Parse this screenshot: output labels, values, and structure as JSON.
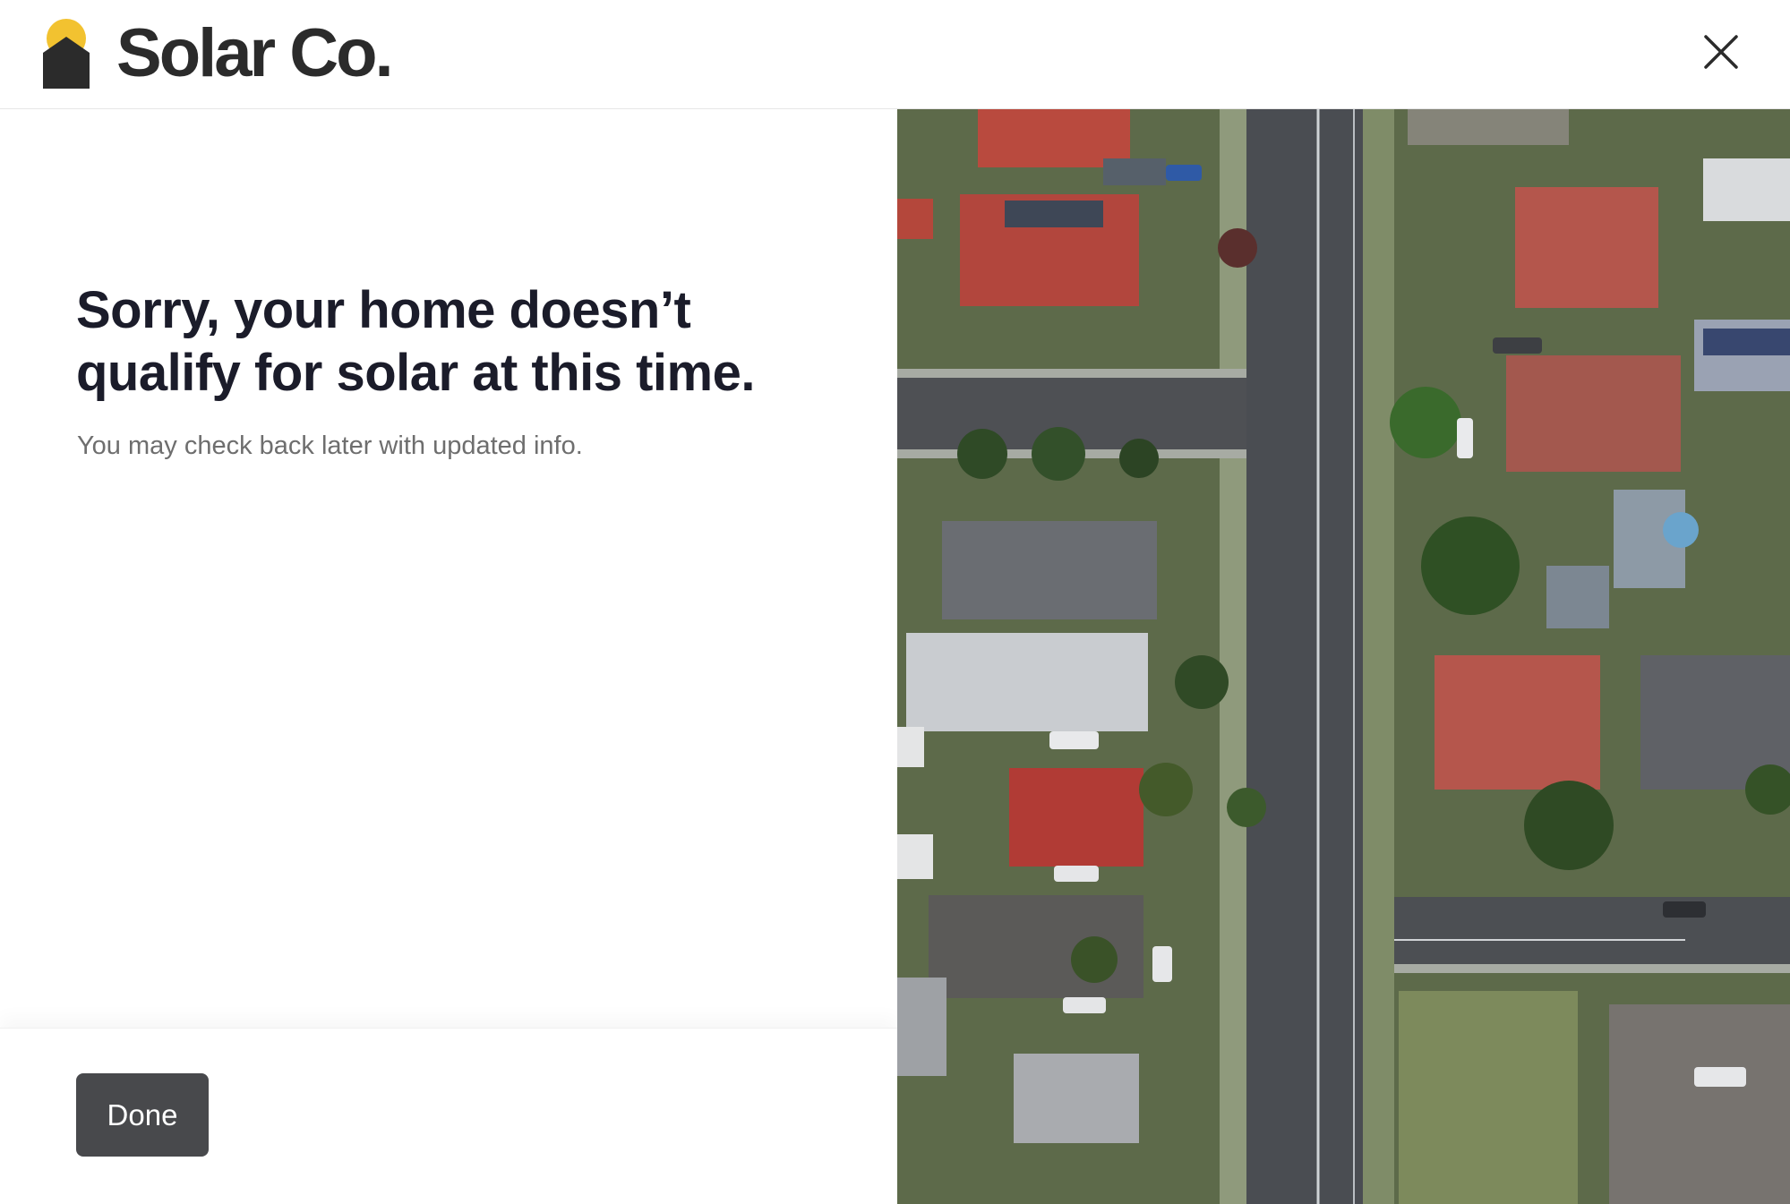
{
  "header": {
    "brand_name": "Solar Co.",
    "close_icon": "close-icon",
    "logo_icon": "house-sun-logo-icon"
  },
  "main": {
    "headline": "Sorry, your home doesn’t qualify for solar at this time.",
    "subtext": "You may check back later with updated info."
  },
  "footer": {
    "done_label": "Done"
  },
  "image": {
    "description_icon": "aerial-neighborhood-photo"
  },
  "colors": {
    "brand_sun": "#F2C230",
    "brand_house": "#2B2B2B",
    "button_bg": "#48494C",
    "headline": "#1B1C2A",
    "subtext": "#6E6E6E"
  }
}
